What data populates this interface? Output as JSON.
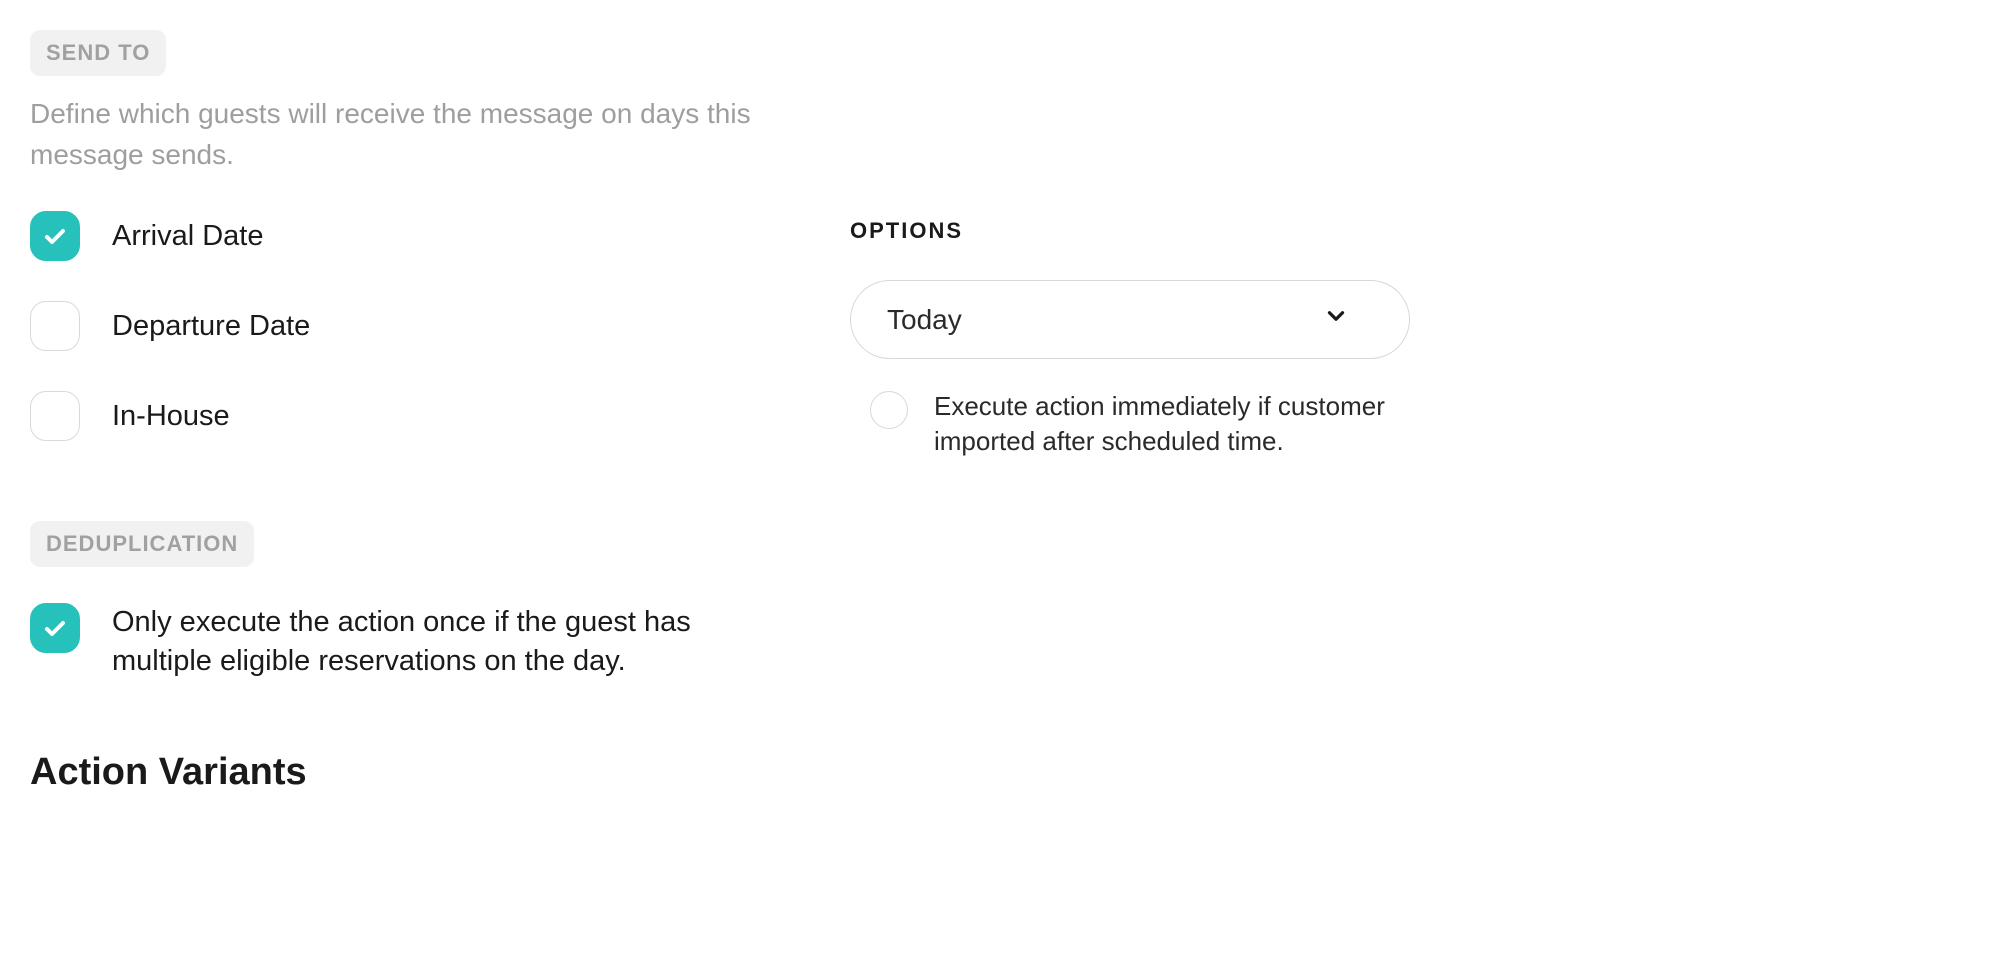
{
  "send_to": {
    "tag": "SEND TO",
    "description": "Define which guests will receive the message on days this message sends.",
    "options": [
      {
        "label": "Arrival Date",
        "checked": true
      },
      {
        "label": "Departure Date",
        "checked": false
      },
      {
        "label": "In-House",
        "checked": false
      }
    ]
  },
  "deduplication": {
    "tag": "DEDUPLICATION",
    "label": "Only execute the action once if the guest has multiple eligible reservations on the day.",
    "checked": true
  },
  "action_variants_heading": "Action Variants",
  "options_panel": {
    "heading": "OPTIONS",
    "select_value": "Today",
    "execute_immediately": {
      "label": "Execute action immediately if customer imported after scheduled time.",
      "checked": false
    }
  }
}
